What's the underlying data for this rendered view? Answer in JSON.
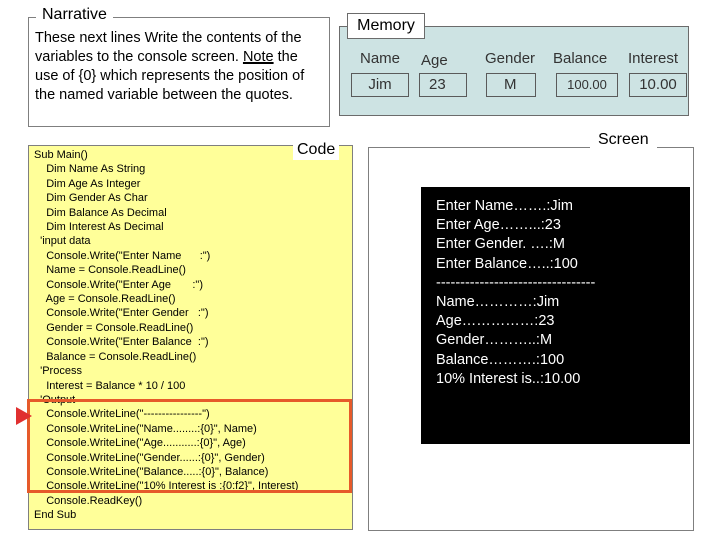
{
  "narrative": {
    "title": "Narrative",
    "text_before": "These next lines Write the contents of the variables to the console screen. ",
    "text_note": "Note",
    "text_after": " the use of {0} which represents the position of the named variable between the quotes."
  },
  "memory": {
    "title": "Memory",
    "headers": [
      "Name",
      "Age",
      "Gender",
      "Balance",
      "Interest"
    ],
    "values": [
      "Jim",
      "23",
      "M",
      "100.00",
      "10.00"
    ]
  },
  "code": {
    "title": "Code",
    "lines": [
      "Sub Main()",
      "    Dim Name As String",
      "    Dim Age As Integer",
      "    Dim Gender As Char",
      "    Dim Balance As Decimal",
      "    Dim Interest As Decimal",
      "  'input data",
      "    Console.Write(\"Enter Name      :\")",
      "    Name = Console.ReadLine()",
      "    Console.Write(\"Enter Age       :\")",
      "    Age = Console.ReadLine()",
      "    Console.Write(\"Enter Gender   :\")",
      "    Gender = Console.ReadLine()",
      "    Console.Write(\"Enter Balance  :\")",
      "    Balance = Console.ReadLine()",
      "  'Process",
      "    Interest = Balance * 10 / 100",
      "  'Output",
      "    Console.WriteLine(\"----------------\")",
      "    Console.WriteLine(\"Name........:{0}\", Name)",
      "    Console.WriteLine(\"Age...........:{0}\", Age)",
      "    Console.WriteLine(\"Gender......:{0}\", Gender)",
      "    Console.WriteLine(\"Balance.....:{0}\", Balance)",
      "    Console.WriteLine(\"10% Interest is :{0:f2}\", Interest)",
      "    Console.ReadKey()",
      "End Sub"
    ]
  },
  "screen": {
    "title": "Screen",
    "lines": [
      "Enter Name…….:Jim",
      "Enter Age……...:23",
      "Enter Gender. ….:M",
      "Enter Balance…..:100",
      "---------------------------------",
      "Name…………:Jim",
      "Age……………:23",
      "Gender………..:M",
      "Balance……….:100",
      "10% Interest is..:10.00"
    ]
  },
  "colors": {
    "memory_bg": "#cde3e3",
    "code_bg": "#ffff99",
    "highlight": "#e65a2a",
    "pointer": "#e03030",
    "console_bg": "#000000",
    "console_text": "#ffffff"
  }
}
